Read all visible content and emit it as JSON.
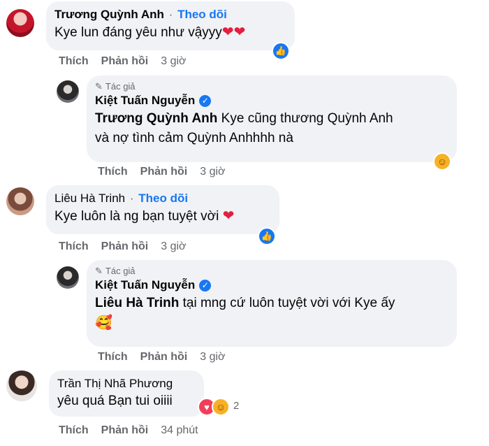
{
  "comments": [
    {
      "name": "Trương Quỳnh Anh",
      "follow": "Theo dõi",
      "text": "Kye lun đáng yêu như vậyyy",
      "actions": {
        "like": "Thích",
        "reply": "Phản hồi",
        "time": "3 giờ"
      }
    },
    {
      "author_tag": "Tác giả",
      "name": "Kiệt Tuấn Nguyễn",
      "mention": "Trương Quỳnh Anh",
      "text_line1": " Kye cũng thương Quỳnh Anh",
      "text_line2": "và nợ tình cảm Quỳnh Anhhhh nà",
      "actions": {
        "like": "Thích",
        "reply": "Phản hồi",
        "time": "3 giờ"
      }
    },
    {
      "name": "Liêu Hà Trinh",
      "follow": "Theo dõi",
      "text": "Kye luôn là ng bạn tuyệt vời",
      "actions": {
        "like": "Thích",
        "reply": "Phản hồi",
        "time": "3 giờ"
      }
    },
    {
      "author_tag": "Tác giả",
      "name": "Kiệt Tuấn Nguyễn",
      "mention": "Liêu Hà Trinh",
      "text_line1": " tại mng cứ luôn tuyệt vời với Kye ấy",
      "actions": {
        "like": "Thích",
        "reply": "Phản hồi",
        "time": "3 giờ"
      }
    },
    {
      "name": "Trần Thị Nhã Phương",
      "text": "yêu quá Bạn tui oiiii",
      "reaction_count": "2",
      "actions": {
        "like": "Thích",
        "reply": "Phản hồi",
        "time": "34 phút"
      }
    }
  ],
  "icons": {
    "like": "like-icon",
    "care": "care-icon",
    "heart": "heart-icon",
    "verified": "verified-badge-icon",
    "author": "pencil-icon"
  },
  "colors": {
    "accent": "#1877f2",
    "bubble": "#f0f2f5",
    "muted": "#65676b",
    "heart": "#f33e58"
  }
}
